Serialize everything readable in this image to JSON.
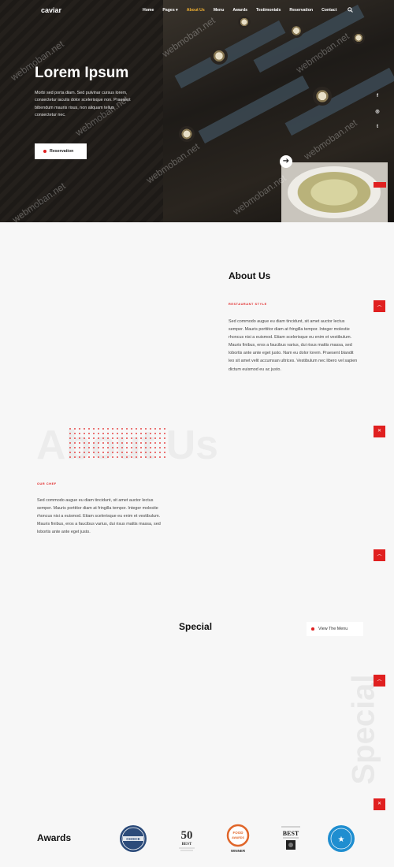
{
  "nav": {
    "logo": "caviar",
    "items": [
      {
        "label": "Home",
        "active": false
      },
      {
        "label": "Pages ▾",
        "active": false
      },
      {
        "label": "About Us",
        "active": true
      },
      {
        "label": "Menu",
        "active": false
      },
      {
        "label": "Awards",
        "active": false
      },
      {
        "label": "Testimonials",
        "active": false
      },
      {
        "label": "Reservation",
        "active": false
      },
      {
        "label": "Contact",
        "active": false
      }
    ],
    "search_icon": "search-icon",
    "active_color": "#f2b233"
  },
  "hero": {
    "title": "Lorem Ipsum",
    "text": "Morbi sed porta diam. Sed pulvinar cursus lorem, consectetur iaculis dolor scelerisque non. Praesent bibendum mauris risus, non aliquam tellus consectetur nec.",
    "reservation_label": "Reservation",
    "social": [
      "f",
      "◎",
      "t"
    ],
    "next_icon": "arrow-right-icon"
  },
  "watermark": "webmoban.net",
  "about": {
    "title": "About Us",
    "kicker": "RESTAURANT STYLE",
    "text": "Sed commodo augue eu diam tincidunt, sit amet auctor lectus semper. Mauris porttitor diam at fringilla tempor. Integer molestie rhoncus nisi a euismod. Etiam scelerisque eu enim et vestibulum. Mauris finibus, eros a faucibus varius, dui risus mattis massa, sed lobortis ante ante eget justo. Nam eu dolor lorem. Praesent blandit leo sit amet velit accumsan ultrices. Vestibulum nec libero vel sapien dictum euismod eu ac justo.",
    "bg_word": "About Us"
  },
  "chef": {
    "kicker": "OUR CHEF",
    "text": "Sed commodo augue eu diam tincidunt, sit amet auctor lectus semper. Mauris porttitor diam at fringilla tempor. Integer molestie rhoncus nisi a euismod. Etiam scelerisque eu enim et vestibulum. Mauris finibus, eros a faucibus varius, dui risus mattis massa, sed lobortis ante ante eget justo."
  },
  "special": {
    "title": "Special",
    "view_menu_label": "View The Menu",
    "bg_word": "Special"
  },
  "awards": {
    "title": "Awards",
    "logos": [
      {
        "name": "choice-award-badge",
        "text": "CHOICE"
      },
      {
        "name": "fifty-best-badge",
        "text": "50 BEST"
      },
      {
        "name": "food-awards-badge",
        "text": "FOOD AWARDS",
        "sub": "WINNER"
      },
      {
        "name": "best-restaurant-badge",
        "text": "BEST"
      },
      {
        "name": "blue-award-badge",
        "text": "★"
      }
    ]
  },
  "side_buttons": [
    "chevron-up-icon",
    "crossed-utensils-icon",
    "chevron-up-icon",
    "chevron-up-icon",
    "crossed-utensils-icon"
  ],
  "colors": {
    "accent": "#e02020",
    "dark": "#111111"
  }
}
